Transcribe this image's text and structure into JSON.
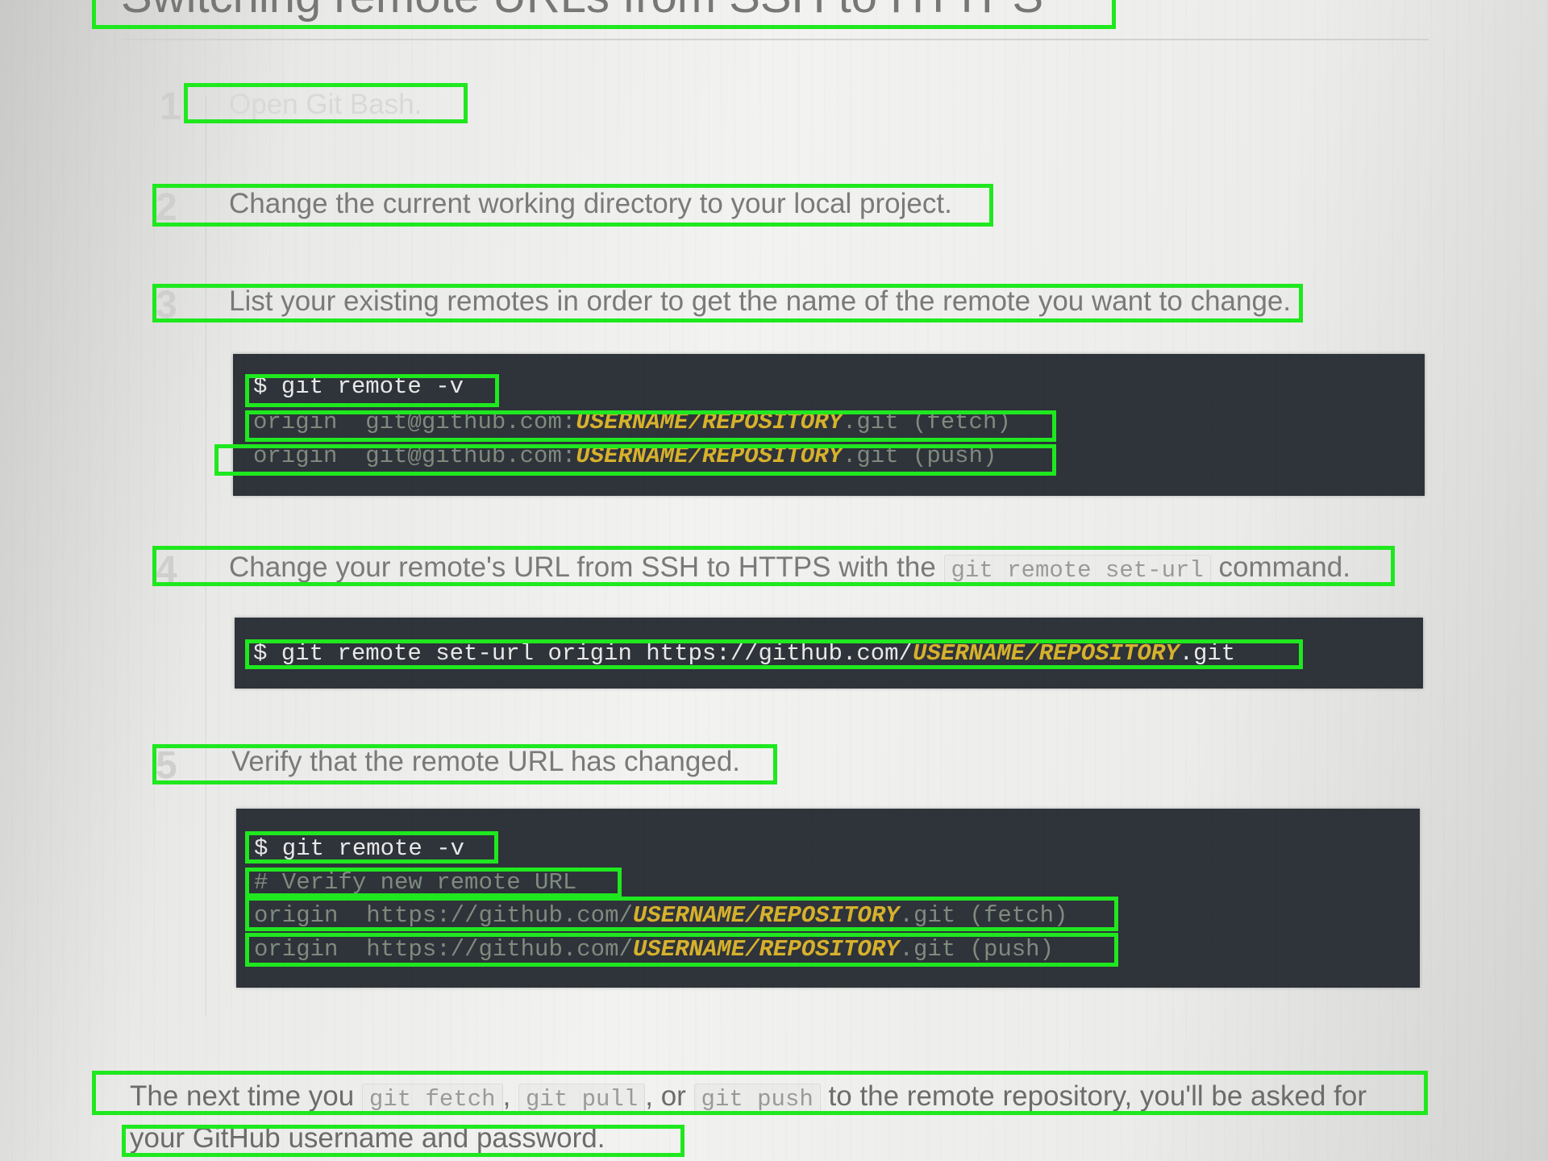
{
  "title": "Switching remote URLs from SSH to HTTPS",
  "steps": [
    {
      "num": "1",
      "text": "Open Git Bash."
    },
    {
      "num": "2",
      "text": "Change the current working directory to your local project."
    },
    {
      "num": "3",
      "text": "List your existing remotes in order to get the name of the remote you want to change."
    },
    {
      "num": "4",
      "text_before": "Change your remote's URL from SSH to HTTPS with the ",
      "code": "git remote set-url",
      "text_after": " command."
    },
    {
      "num": "5",
      "text": "Verify that the remote URL has changed."
    }
  ],
  "code_blocks": {
    "block1": {
      "cmd": "$ git remote -v",
      "line1_pre": "origin  git@github.com:",
      "line1_hl": "USERNAME/REPOSITORY",
      "line1_post": ".git (fetch)",
      "line2_pre": "origin  git@github.com:",
      "line2_hl": "USERNAME/REPOSITORY",
      "line2_post": ".git (push)"
    },
    "block2": {
      "cmd_pre": "$ git remote set-url origin https://github.com/",
      "cmd_hl": "USERNAME/REPOSITORY",
      "cmd_post": ".git"
    },
    "block3": {
      "cmd": "$ git remote -v",
      "comment": "# Verify new remote URL",
      "line1_pre": "origin  https://github.com/",
      "line1_hl": "USERNAME/REPOSITORY",
      "line1_post": ".git (fetch)",
      "line2_pre": "origin  https://github.com/",
      "line2_hl": "USERNAME/REPOSITORY",
      "line2_post": ".git (push)"
    }
  },
  "footer": {
    "t1": "The next time you ",
    "c1": "git fetch",
    "t2": ", ",
    "c2": "git pull",
    "t3": ", or ",
    "c3": "git push",
    "t4": " to the remote repository, you'll be asked for",
    "line2": "your GitHub username and password."
  },
  "colors": {
    "annotation_box": "#1fe81f",
    "code_bg": "#2f333a",
    "code_highlight": "#d6b12c"
  }
}
